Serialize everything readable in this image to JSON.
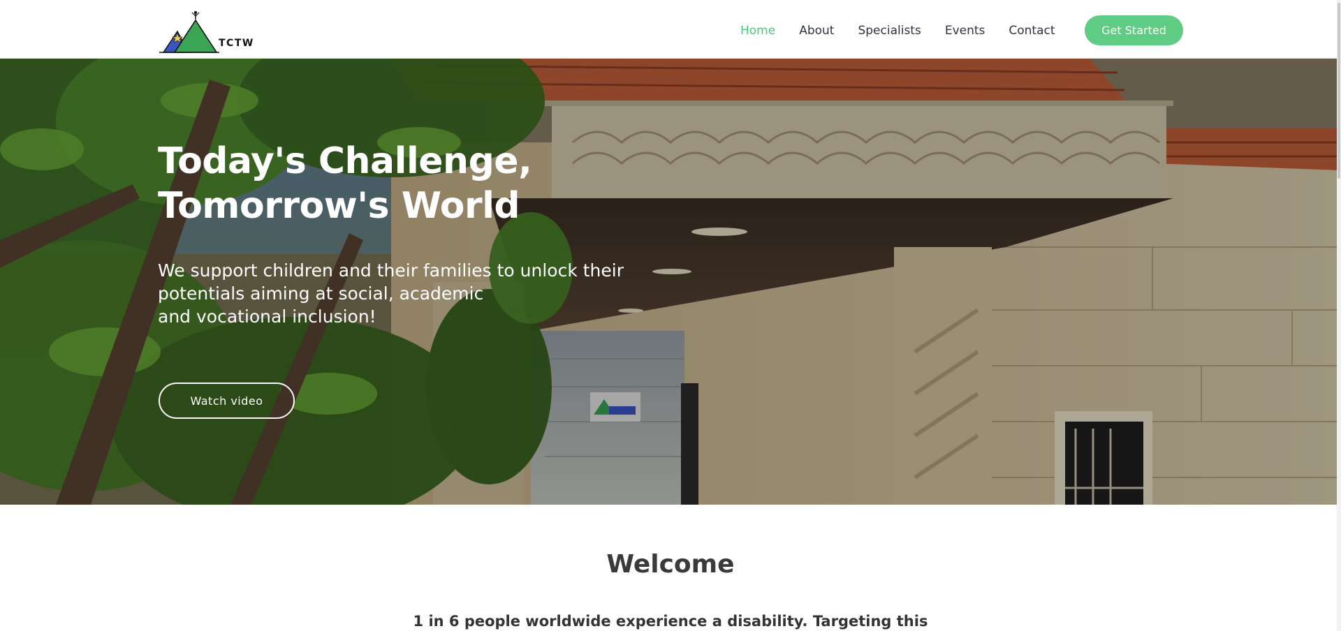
{
  "header": {
    "logo_top_text": "TCTW",
    "logo_text": "TCTW",
    "nav": [
      {
        "label": "Home",
        "active": true
      },
      {
        "label": "About",
        "active": false
      },
      {
        "label": "Specialists",
        "active": false
      },
      {
        "label": "Events",
        "active": false
      },
      {
        "label": "Contact",
        "active": false
      }
    ],
    "cta_label": "Get Started"
  },
  "hero": {
    "title_line1": "Today's Challenge,",
    "title_line2": "Tomorrow's World",
    "subtitle_line1": "We support children and their families to unlock their",
    "subtitle_line2": "potentials aiming at social, academic",
    "subtitle_line3": "and vocational inclusion!",
    "video_button": "Watch video"
  },
  "welcome": {
    "title": "Welcome",
    "text": "1 in 6 people worldwide experience a disability. Targeting this"
  },
  "colors": {
    "accent": "#5fcc84",
    "nav_active": "#4ec37a",
    "nav_text": "#2e3440",
    "logo_green": "#3aa655",
    "logo_blue": "#3b55c5",
    "logo_yellow": "#f0d33a"
  }
}
